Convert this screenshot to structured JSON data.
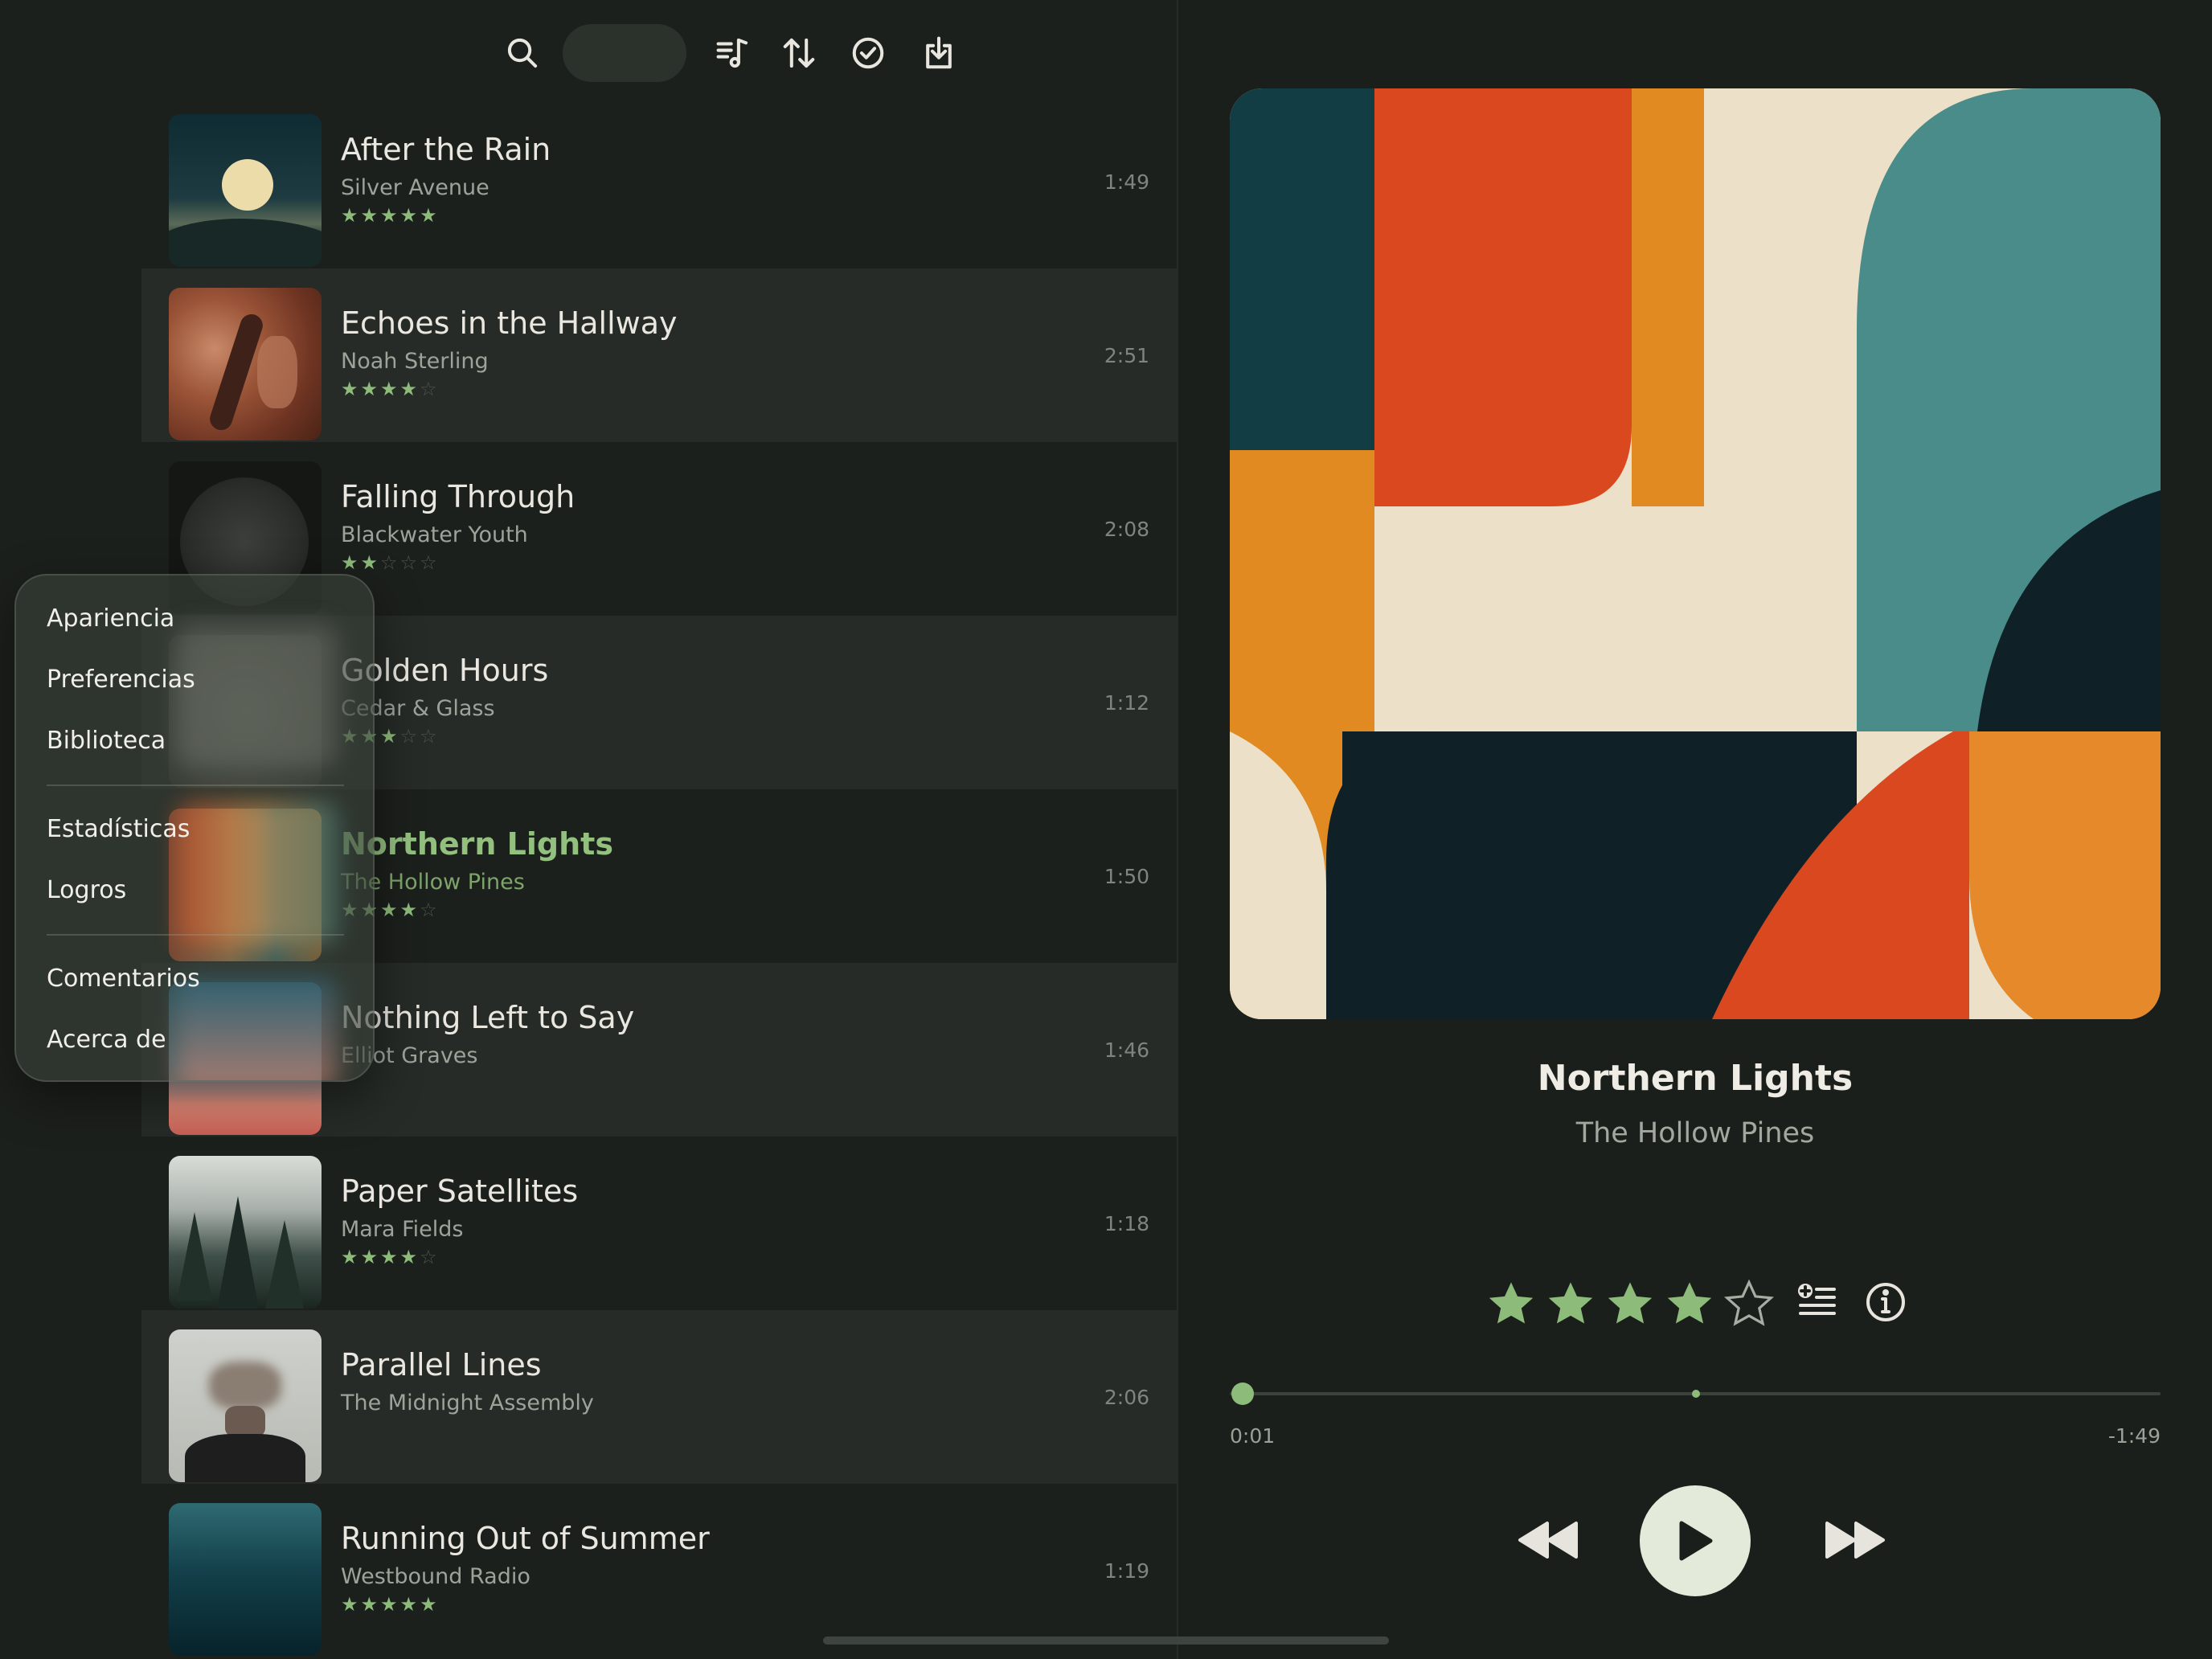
{
  "toolbar": {
    "icons": [
      "search-icon",
      "queue-music-icon",
      "sort-icon",
      "checkmark-circle-icon",
      "download-icon"
    ]
  },
  "songs": [
    {
      "title": "After the Rain",
      "artist": "Silver Avenue",
      "rating": 5,
      "duration": "1:49"
    },
    {
      "title": "Echoes in the Hallway",
      "artist": "Noah Sterling",
      "rating": 4,
      "duration": "2:51"
    },
    {
      "title": "Falling Through",
      "artist": "Blackwater Youth",
      "rating": 2,
      "duration": "2:08"
    },
    {
      "title": "Golden Hours",
      "artist": "Cedar & Glass",
      "rating": 3,
      "duration": "1:12"
    },
    {
      "title": "Northern Lights",
      "artist": "The Hollow Pines",
      "rating": 4,
      "duration": "1:50",
      "playing": true
    },
    {
      "title": "Nothing Left to Say",
      "artist": "Elliot Graves",
      "rating": 0,
      "duration": "1:46"
    },
    {
      "title": "Paper Satellites",
      "artist": "Mara Fields",
      "rating": 4,
      "duration": "1:18"
    },
    {
      "title": "Parallel Lines",
      "artist": "The Midnight Assembly",
      "rating": 0,
      "duration": "2:06"
    },
    {
      "title": "Running Out of Summer",
      "artist": "Westbound Radio",
      "rating": 5,
      "duration": "1:19"
    }
  ],
  "menu": {
    "items": [
      "Apariencia",
      "Preferencias",
      "Biblioteca",
      "Estadísticas",
      "Logros",
      "Comentarios",
      "Acerca de"
    ]
  },
  "now_playing": {
    "title": "Northern Lights",
    "artist": "The Hollow Pines",
    "rating": 4,
    "elapsed": "0:01",
    "remaining": "-1:49",
    "progress": 0.01
  },
  "colors": {
    "accent": "#8dbb7a",
    "background": "#1b1f1b",
    "row_alt": "#262b27"
  }
}
